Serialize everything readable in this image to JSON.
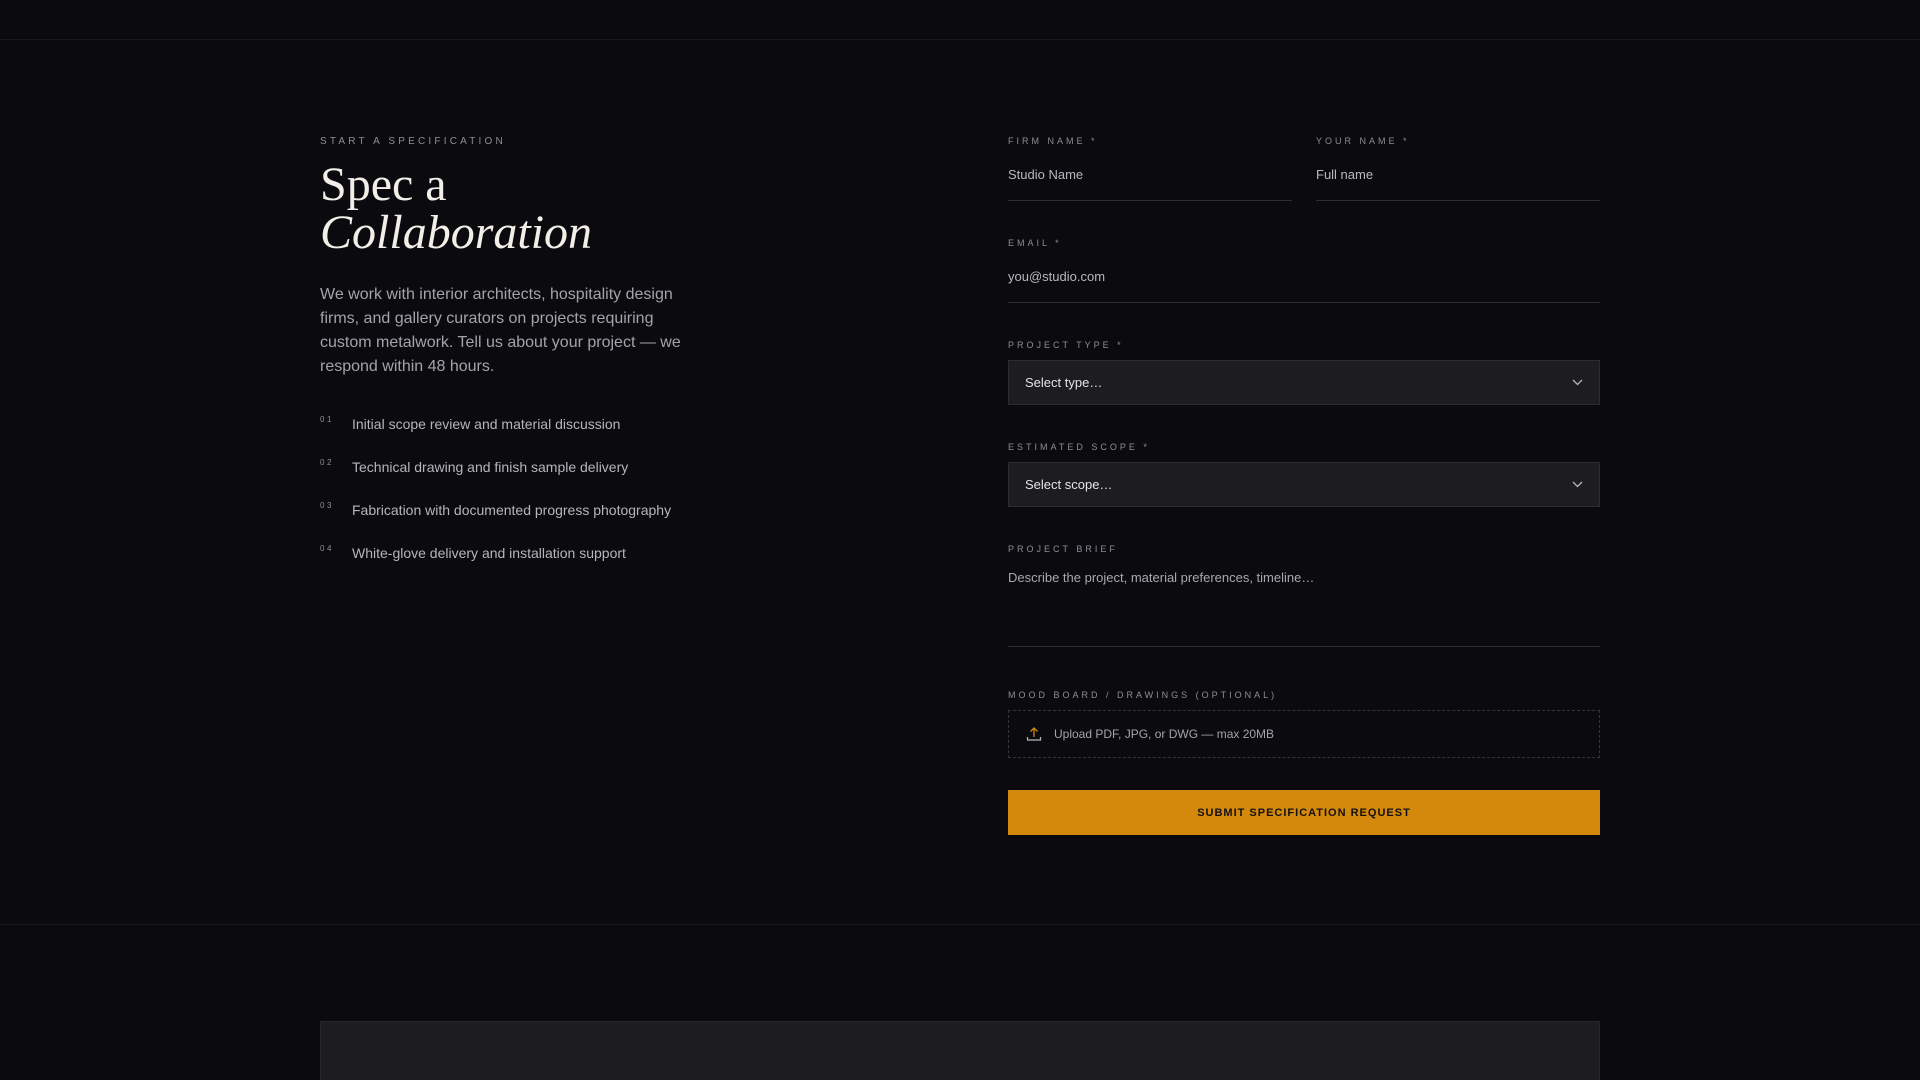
{
  "intro_section": {
    "eyebrow": "START A SPECIFICATION",
    "title_line1": "Spec a",
    "title_line2": "Collaboration",
    "description": "We work with interior architects, hospitality design firms, and gallery curators on projects requiring custom metalwork. Tell us about your project — we respond within 48 hours.",
    "steps": [
      {
        "num": "01",
        "text": "Initial scope review and material discussion"
      },
      {
        "num": "02",
        "text": "Technical drawing and finish sample delivery"
      },
      {
        "num": "03",
        "text": "Fabrication with documented progress photography"
      },
      {
        "num": "04",
        "text": "White-glove delivery and installation support"
      }
    ]
  },
  "form": {
    "firm_name": {
      "label": "FIRM NAME *",
      "placeholder": "Studio Name",
      "value": ""
    },
    "your_name": {
      "label": "YOUR NAME *",
      "placeholder": "Full name",
      "value": ""
    },
    "email": {
      "label": "EMAIL *",
      "placeholder": "you@studio.com",
      "value": ""
    },
    "project_type": {
      "label": "PROJECT TYPE *",
      "selected": "Select type…"
    },
    "estimated_scope": {
      "label": "ESTIMATED SCOPE *",
      "selected": "Select scope…"
    },
    "project_brief": {
      "label": "PROJECT BRIEF",
      "placeholder": "Describe the project, material preferences, timeline…"
    },
    "upload": {
      "label": "MOOD BOARD / DRAWINGS (OPTIONAL)",
      "text": "Upload PDF, JPG, or DWG — max 20MB",
      "icon": "upload-icon"
    },
    "submit_label": "SUBMIT SPECIFICATION REQUEST"
  },
  "colors": {
    "background": "#0b0b0f",
    "accent": "#d4880c",
    "field_bg": "#1c1c21"
  }
}
